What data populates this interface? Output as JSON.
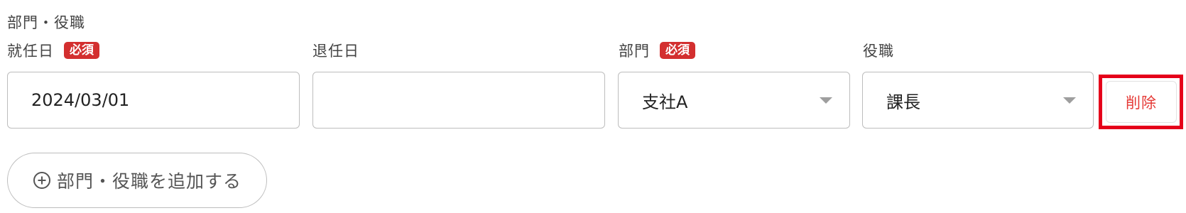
{
  "section": {
    "title": "部門・役職"
  },
  "fields": {
    "start_date": {
      "label": "就任日",
      "required_badge": "必須",
      "value": "2024/03/01"
    },
    "end_date": {
      "label": "退任日",
      "value": ""
    },
    "department": {
      "label": "部門",
      "required_badge": "必須",
      "value": "支社A"
    },
    "position": {
      "label": "役職",
      "value": "課長"
    }
  },
  "actions": {
    "delete_label": "削除",
    "add_label": "部門・役職を追加する"
  },
  "colors": {
    "required_badge": "#d32f2f",
    "delete_text": "#e53935",
    "highlight_border": "#e5001a",
    "input_border": "#bdbdbd"
  },
  "icons": {
    "add": "plus-circle-icon",
    "dropdown": "caret-down-icon"
  }
}
